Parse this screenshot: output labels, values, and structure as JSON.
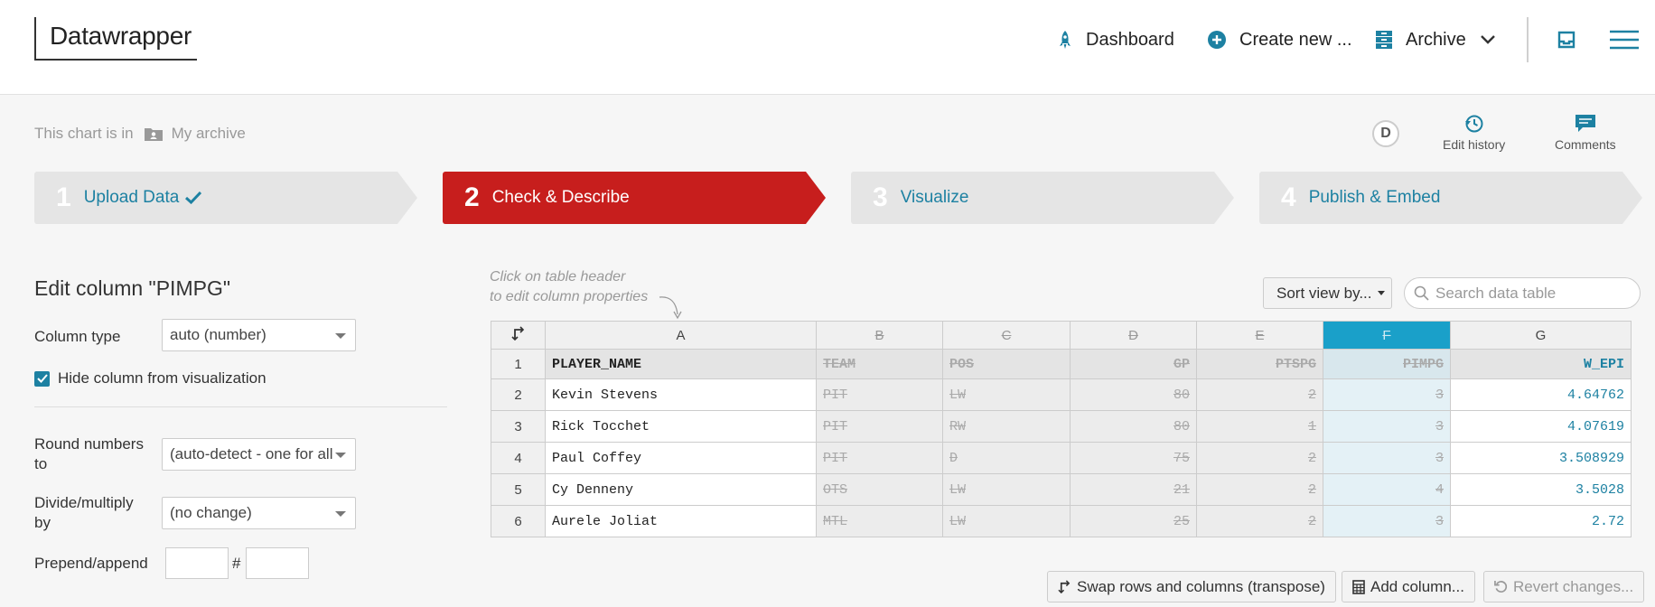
{
  "header": {
    "logo": "Datawrapper",
    "nav": {
      "dashboard": "Dashboard",
      "create_new": "Create new ...",
      "archive": "Archive"
    }
  },
  "archive_line": {
    "prefix": "This chart is in",
    "folder": "My archive"
  },
  "tools": {
    "user_initial": "D",
    "edit_history": "Edit history",
    "comments": "Comments"
  },
  "steps": [
    {
      "num": "1",
      "label": "Upload Data"
    },
    {
      "num": "2",
      "label": "Check & Describe"
    },
    {
      "num": "3",
      "label": "Visualize"
    },
    {
      "num": "4",
      "label": "Publish & Embed"
    }
  ],
  "edit_column": {
    "title": "Edit column \"PIMPG\"",
    "column_type_label": "Column type",
    "column_type_value": "auto (number)",
    "hide_label": "Hide column from visualization",
    "round_label": "Round numbers to",
    "round_value": "(auto-detect - one for all",
    "divide_label": "Divide/multiply by",
    "divide_value": "(no change)",
    "prepend_label": "Prepend/append",
    "prepend_sep": "#"
  },
  "table_area": {
    "hint_line1": "Click on table header",
    "hint_line2": "to edit column properties",
    "sort_label": "Sort view by...",
    "search_placeholder": "Search data table"
  },
  "table": {
    "col_letters": [
      "A",
      "B",
      "C",
      "D",
      "E",
      "F",
      "G"
    ],
    "header": [
      "PLAYER_NAME",
      "TEAM",
      "POS",
      "GP",
      "PTSPG",
      "PIMPG",
      "W_EPI"
    ],
    "rows": [
      [
        "Kevin Stevens",
        "PIT",
        "LW",
        "80",
        "2",
        "3",
        "4.64762"
      ],
      [
        "Rick Tocchet",
        "PIT",
        "RW",
        "80",
        "1",
        "3",
        "4.07619"
      ],
      [
        "Paul Coffey",
        "PIT",
        "D",
        "75",
        "2",
        "3",
        "3.508929"
      ],
      [
        "Cy Denneny",
        "OTS",
        "LW",
        "21",
        "2",
        "4",
        "3.5028"
      ],
      [
        "Aurele Joliat",
        "MTL",
        "LW",
        "25",
        "2",
        "3",
        "2.72"
      ]
    ],
    "row_numbers": [
      "1",
      "2",
      "3",
      "4",
      "5",
      "6"
    ]
  },
  "bottom_buttons": {
    "transpose": "Swap rows and columns (transpose)",
    "add_column": "Add column...",
    "revert": "Revert changes..."
  },
  "colors": {
    "active_step": "#c71e1d",
    "accent": "#1d81a2",
    "selected_column": "#1aa0c9"
  }
}
